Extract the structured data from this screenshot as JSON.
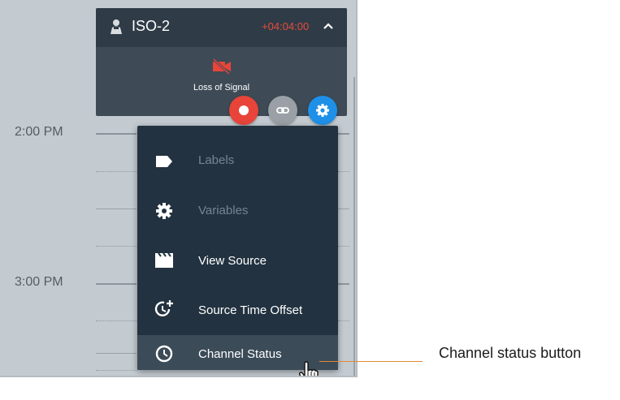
{
  "timeline": {
    "times": [
      "2:00 PM",
      "3:00 PM"
    ]
  },
  "card": {
    "title": "ISO-2",
    "offset": "+04:04:00",
    "status": "Loss of Signal",
    "offset_color": "#e8493d"
  },
  "card_actions": [
    {
      "name": "record-button",
      "icon": "record-icon",
      "color": "#e8443a"
    },
    {
      "name": "link-button",
      "icon": "link-icon",
      "color": "#9aa0a5"
    },
    {
      "name": "settings-button",
      "icon": "gear-icon",
      "color": "#1e90e8"
    }
  ],
  "menu": {
    "items": [
      {
        "label": "Labels",
        "icon": "label-tag-icon",
        "enabled": false
      },
      {
        "label": "Variables",
        "icon": "gear-icon",
        "enabled": false
      },
      {
        "label": "View Source",
        "icon": "clapperboard-icon",
        "enabled": true
      },
      {
        "label": "Source Time Offset",
        "icon": "clock-plus-icon",
        "enabled": true
      },
      {
        "label": "Channel Status",
        "icon": "clock-icon",
        "enabled": true,
        "highlighted": true
      }
    ]
  },
  "annotation": {
    "callout": "Channel status button",
    "line_color": "#e08a3c"
  }
}
